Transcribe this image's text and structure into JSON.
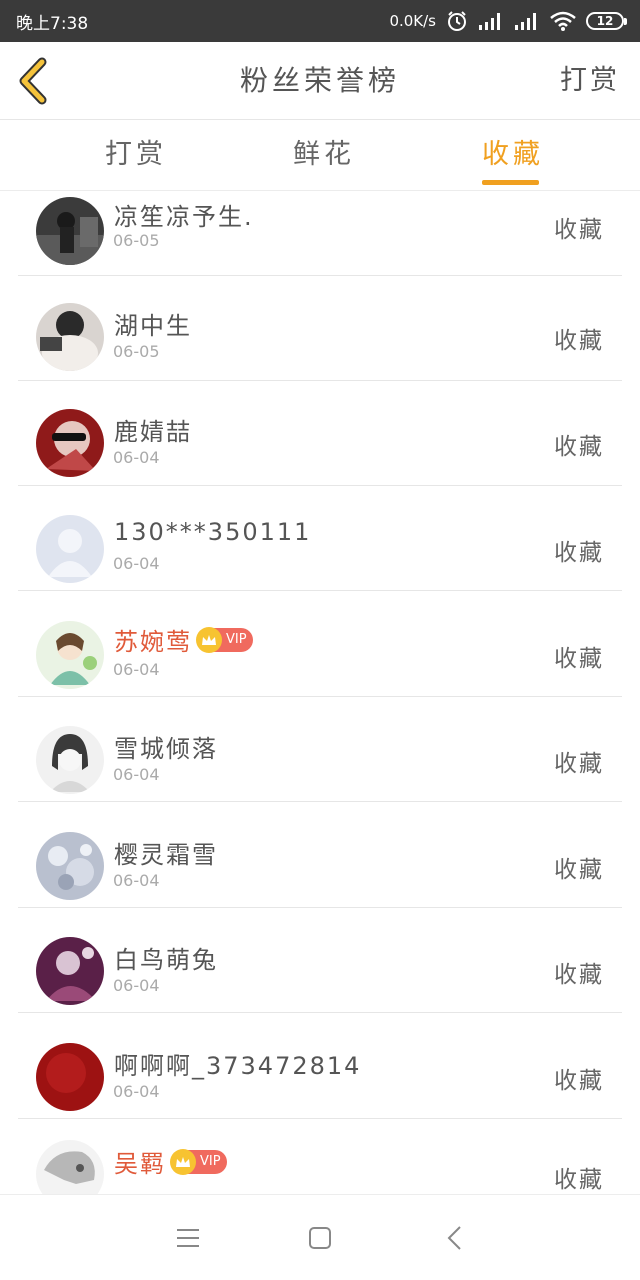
{
  "status_bar": {
    "time": "晚上7:38",
    "network_speed": "0.0K/s",
    "battery": "12",
    "icons": [
      "alarm-icon",
      "signal-icon",
      "signal-icon",
      "wifi-icon",
      "battery-icon"
    ]
  },
  "header": {
    "title": "粉丝荣誉榜",
    "action": "打赏",
    "back_icon": "chevron-left-icon"
  },
  "tabs": [
    {
      "label": "打赏",
      "active": false
    },
    {
      "label": "鲜花",
      "active": false
    },
    {
      "label": "收藏",
      "active": true
    }
  ],
  "colors": {
    "accent": "#f0a020",
    "vip_name": "#e05a3a",
    "vip_badge": "#f06a5e",
    "status_bar": "#3a3a3a"
  },
  "rows": [
    {
      "name": "凉笙凉予生.",
      "date": "06-05",
      "action": "收藏",
      "vip": false
    },
    {
      "name": "湖中生",
      "date": "06-05",
      "action": "收藏",
      "vip": false
    },
    {
      "name": "鹿婧喆",
      "date": "06-04",
      "action": "收藏",
      "vip": false
    },
    {
      "name": "130***350111",
      "date": "06-04",
      "action": "收藏",
      "vip": false
    },
    {
      "name": "苏婉莺",
      "date": "06-04",
      "action": "收藏",
      "vip": true,
      "badge": "VIP"
    },
    {
      "name": "雪城倾落",
      "date": "06-04",
      "action": "收藏",
      "vip": false
    },
    {
      "name": "樱灵霜雪",
      "date": "06-04",
      "action": "收藏",
      "vip": false
    },
    {
      "name": "白鸟萌兔",
      "date": "06-04",
      "action": "收藏",
      "vip": false
    },
    {
      "name": "啊啊啊_373472814",
      "date": "06-04",
      "action": "收藏",
      "vip": false
    },
    {
      "name": "吴羁",
      "date": "",
      "action": "收藏",
      "vip": true,
      "badge": "VIP"
    }
  ],
  "nav_bar": {
    "icons": [
      "menu-icon",
      "home-square-icon",
      "back-triangle-icon"
    ]
  }
}
